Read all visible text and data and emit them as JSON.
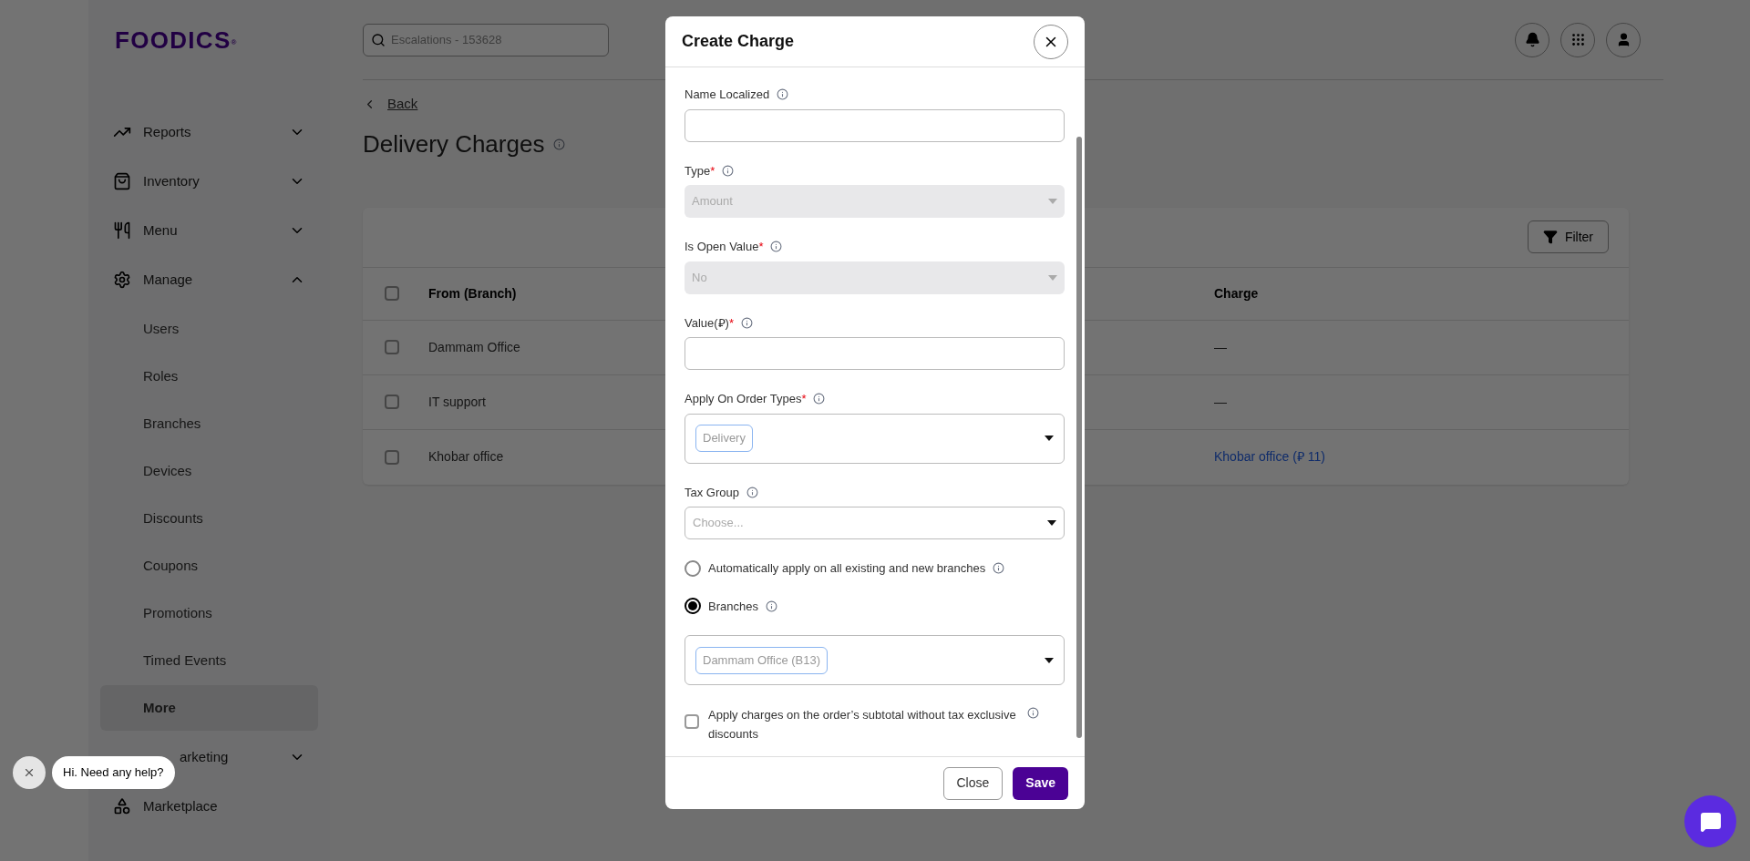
{
  "sidebar": {
    "logo": "FOODICS",
    "logo_mark": "®",
    "items": [
      {
        "label": "Reports",
        "expanded": false
      },
      {
        "label": "Inventory",
        "expanded": false
      },
      {
        "label": "Menu",
        "expanded": false
      },
      {
        "label": "Manage",
        "expanded": true,
        "children": [
          {
            "label": "Users",
            "selected": false
          },
          {
            "label": "Roles",
            "selected": false
          },
          {
            "label": "Branches",
            "selected": false
          },
          {
            "label": "Devices",
            "selected": false
          },
          {
            "label": "Discounts",
            "selected": false
          },
          {
            "label": "Coupons",
            "selected": false
          },
          {
            "label": "Promotions",
            "selected": false
          },
          {
            "label": "Timed Events",
            "selected": false
          },
          {
            "label": "More",
            "selected": true
          }
        ]
      },
      {
        "label": "arketing",
        "expanded": false
      },
      {
        "label": "Marketplace"
      }
    ]
  },
  "topbar": {
    "search": {
      "placeholder": "Escalations - 153628"
    }
  },
  "page": {
    "back": "Back",
    "title": "Delivery Charges",
    "filter": "Filter",
    "table": {
      "all_checked": false,
      "columns": [
        {
          "label": "From (Branch)"
        },
        {
          "label": "Charge"
        }
      ],
      "rows": [
        {
          "kind": "text",
          "checked": false,
          "from": "Dammam Office",
          "charge": "—"
        },
        {
          "kind": "text",
          "checked": false,
          "from": "IT support",
          "charge": "—"
        },
        {
          "kind": "link",
          "checked": false,
          "from": "Khobar office",
          "charge": "Khobar office (⃁ 11)"
        }
      ]
    }
  },
  "modal": {
    "title": "Create Charge",
    "fields": [
      {
        "kind": "input",
        "label": "Name Localized"
      },
      {
        "kind": "select",
        "label": "Type",
        "mark": "*",
        "value": "Amount",
        "disabled": true
      },
      {
        "kind": "select",
        "label": "Is Open Value",
        "mark": "*",
        "value": "No",
        "disabled": true
      },
      {
        "kind": "input",
        "label": "Value(⃁)",
        "mark": "*"
      },
      {
        "kind": "multiselect",
        "label": "Apply On Order Types",
        "mark": "*",
        "tags": [
          "Delivery"
        ]
      },
      {
        "kind": "select",
        "label": "Tax Group",
        "placeholder": "Choose...",
        "disabled": false
      },
      {
        "kind": "radio",
        "label": "Automatically apply on all existing and new branches",
        "selected": false
      },
      {
        "kind": "radio",
        "label": "Branches",
        "selected": true
      },
      {
        "kind": "multiselect",
        "tags": [
          "Dammam Office (B13)"
        ]
      },
      {
        "kind": "checkbox",
        "label": "Apply charges on the order’s subtotal without tax exclusive discounts",
        "checked": false
      }
    ],
    "buttons": [
      {
        "label": "Close",
        "kind": "secondary"
      },
      {
        "label": "Save",
        "kind": "primary"
      }
    ]
  },
  "chat": {
    "message": "Hi. Need any help?"
  }
}
